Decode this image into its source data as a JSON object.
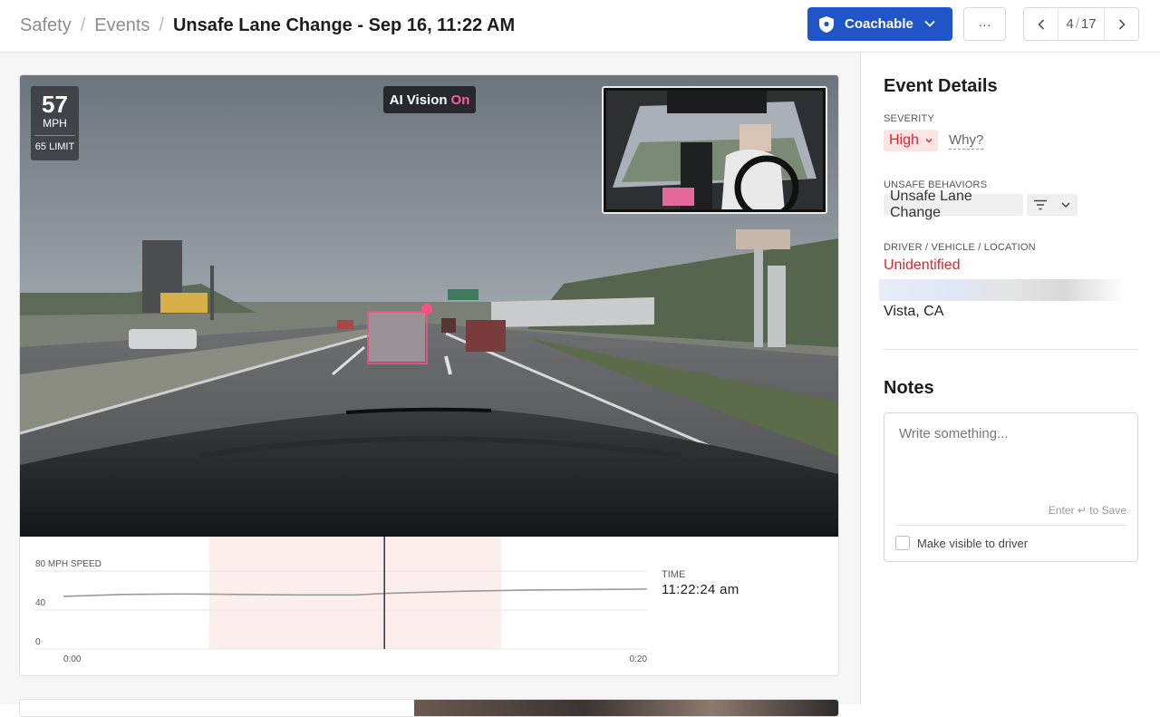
{
  "breadcrumb": {
    "items": [
      "Safety",
      "Events"
    ],
    "separator": "/",
    "current": "Unsafe Lane Change - Sep 16, 11:22 AM"
  },
  "toolbar": {
    "coach_label": "Coachable",
    "coach_icon": "shield-icon",
    "more_label": "···",
    "pager": {
      "current": "4",
      "separator": "/",
      "total": "17"
    },
    "accent_color": "#1f55c9"
  },
  "video": {
    "speed_value": "57",
    "speed_unit": "MPH",
    "speed_limit": "65 LIMIT",
    "ai_label": "AI Vision",
    "ai_state": "On"
  },
  "speed_chart": {
    "time_label": "TIME",
    "time_value": "11:22:24 am"
  },
  "chart_data": {
    "type": "line",
    "ylabel": "MPH SPEED",
    "ylim": [
      0,
      80
    ],
    "yticks": [
      "80",
      "40",
      "0"
    ],
    "xticks": [
      "0:00",
      "0:20"
    ],
    "x": [
      0,
      2,
      4,
      6,
      8,
      10,
      11,
      12,
      14,
      16,
      18,
      20
    ],
    "series": [
      {
        "values": [
          54,
          56,
          56.5,
          56,
          55.5,
          55.5,
          57,
          58,
          59.5,
          60.5,
          61,
          61.5
        ]
      }
    ],
    "highlight_range": [
      5,
      15
    ],
    "cursor_x": 11,
    "line_color": "#999999",
    "highlight_color": "#fdeeee"
  },
  "sidebar": {
    "event_details_title": "Event Details",
    "severity_label": "SEVERITY",
    "severity_value": "High",
    "why_label": "Why?",
    "behaviors_label": "UNSAFE BEHAVIORS",
    "behavior_value": "Unsafe Lane Change",
    "driver_label": "DRIVER / VEHICLE / LOCATION",
    "driver_value": "Unidentified",
    "location_value": "Vista, CA",
    "notes_title": "Notes",
    "notes_placeholder": "Write something...",
    "save_hint": "Enter ↵ to Save",
    "visible_label": "Make visible to driver",
    "severity_color": "#d9262c"
  }
}
